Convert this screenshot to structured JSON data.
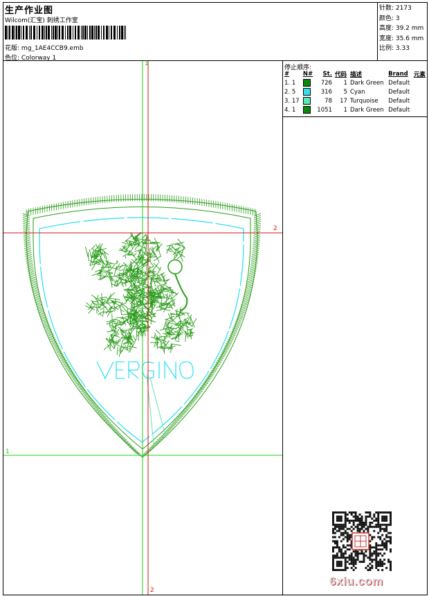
{
  "header": {
    "title": "生产作业图",
    "company": "Wilcom(汇宝) 刺绣工作室",
    "pattern_label": "花版:",
    "pattern_value": "mg_1AE4CCB9.emb",
    "colorway_label": "色位:",
    "colorway_value": "Colorway 1"
  },
  "stats": {
    "stitches": "针数: 2173",
    "colors": "颜色: 3",
    "height": "高度: 39.2 mm",
    "width": "宽度: 35.6 mm",
    "scale": "比例: 3.33"
  },
  "stop_sequence": {
    "title": "停止顺序:",
    "columns": [
      "#",
      "N#",
      "St.",
      "代码",
      "描述",
      "Brand",
      "元素"
    ],
    "rows": [
      {
        "index": "1.",
        "n": "1",
        "color": "#0a8a0a",
        "st": "726",
        "code": "1",
        "desc": "Dark Green",
        "brand": "Default"
      },
      {
        "index": "2.",
        "n": "5",
        "color": "#33e0ee",
        "st": "316",
        "code": "5",
        "desc": "Cyan",
        "brand": "Default"
      },
      {
        "index": "3.",
        "n": "17",
        "color": "#5de8b8",
        "st": "78",
        "code": "17",
        "desc": "Turquoise",
        "brand": "Default"
      },
      {
        "index": "4.",
        "n": "1",
        "color": "#0a8a0a",
        "st": "1051",
        "code": "1",
        "desc": "Dark Green",
        "brand": "Default"
      }
    ]
  },
  "design": {
    "text": "VERGINO",
    "axis_labels": {
      "v_top": "1",
      "v_bottom": "2",
      "h_right": "2",
      "h_left": "1"
    },
    "colors": {
      "stitch_green": "#2a9a1a",
      "cyan": "#33e0ee",
      "axis_green": "#22cc22",
      "axis_red": "#dd1111"
    }
  },
  "watermark": {
    "site": "6xiu.com",
    "qr_icon": "qr-code-icon",
    "seal_icon": "seal-stamp-icon"
  }
}
